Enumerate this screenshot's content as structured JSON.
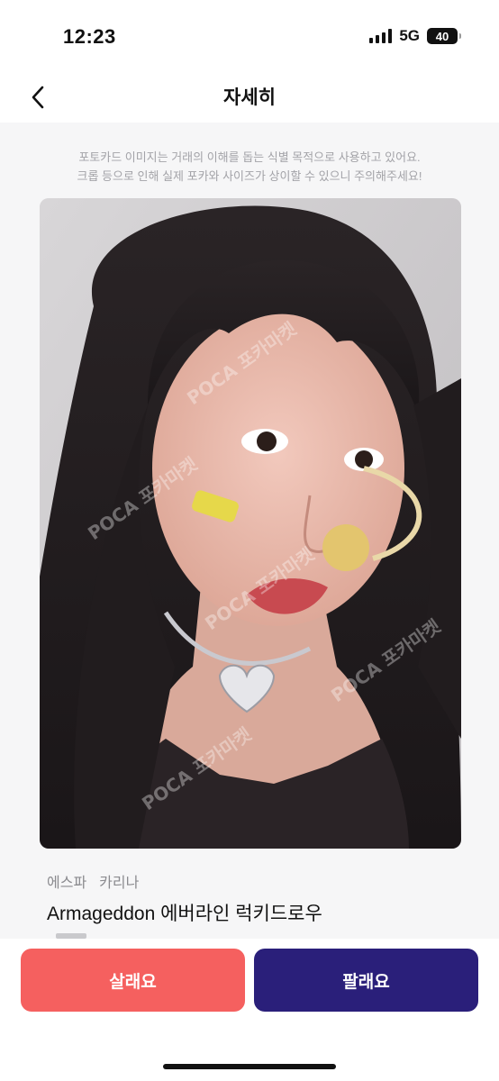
{
  "status_bar": {
    "time": "12:23",
    "network": "5G",
    "battery": "40"
  },
  "header": {
    "title": "자세히"
  },
  "notice": {
    "line1": "포토카드 이미지는 거래의 이해를 돕는 식별 목적으로 사용하고 있어요.",
    "line2": "크롭 등으로 인해 실제 포카와 사이즈가 상이할 수 있으니 주의해주세요!"
  },
  "card": {
    "group": "에스파",
    "member": "카리나",
    "title": "Armageddon 에버라인 럭키드로우",
    "watermark": "POCA 포카마켓"
  },
  "actions": {
    "buy_label": "살래요",
    "sell_label": "팔래요"
  },
  "colors": {
    "buy": "#f5605f",
    "sell": "#2a1f7a",
    "content_bg": "#f6f6f7"
  }
}
